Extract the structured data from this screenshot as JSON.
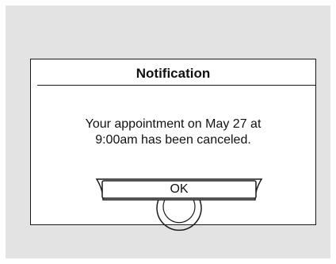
{
  "dialog": {
    "title": "Notification",
    "message_line1": "Your appointment on May 27 at",
    "message_line2": "9:00am has been canceled.",
    "ok_label": "OK"
  }
}
